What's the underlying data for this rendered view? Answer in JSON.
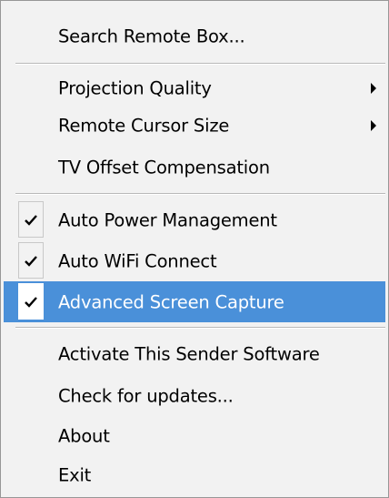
{
  "menu": {
    "items": [
      {
        "label": "Search Remote Box..."
      },
      {
        "label": "Projection Quality",
        "submenu": true
      },
      {
        "label": "Remote Cursor Size",
        "submenu": true
      },
      {
        "label": "TV Offset Compensation"
      },
      {
        "label": "Auto Power Management",
        "checked": true
      },
      {
        "label": "Auto WiFi Connect",
        "checked": true
      },
      {
        "label": "Advanced Screen Capture",
        "checked": true,
        "highlighted": true
      },
      {
        "label": "Activate This Sender Software"
      },
      {
        "label": "Check for updates..."
      },
      {
        "label": "About"
      },
      {
        "label": "Exit"
      }
    ]
  },
  "colors": {
    "menu_background": "#f2f2f2",
    "highlight": "#4a90d9",
    "highlight_text": "#ffffff",
    "text": "#000000",
    "separator": "#b9b9b9"
  },
  "icons": {
    "check": "check-icon",
    "submenu_arrow": "submenu-arrow-icon"
  }
}
